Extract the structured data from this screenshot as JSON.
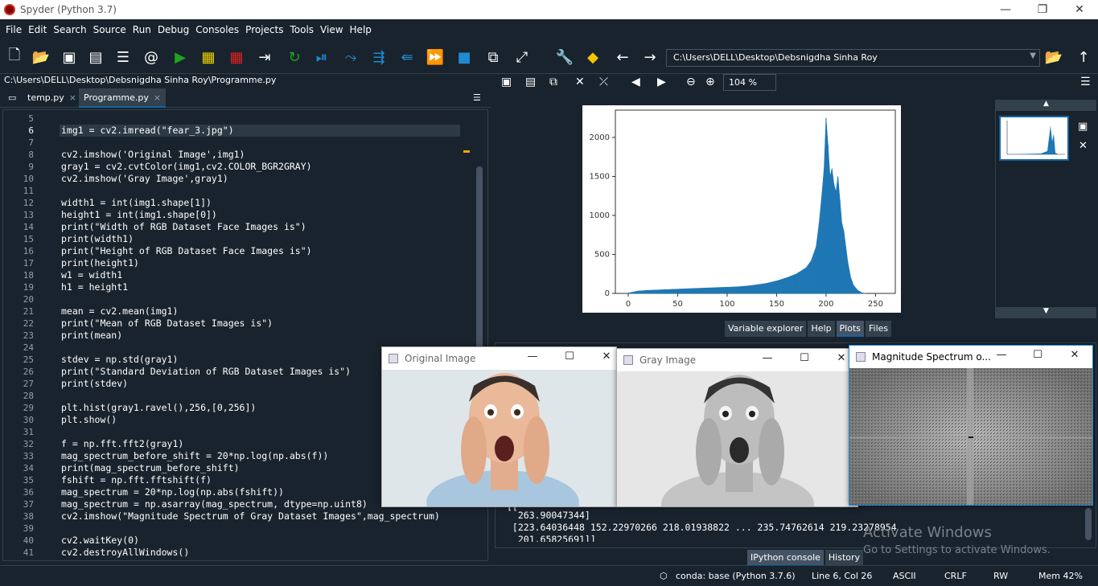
{
  "window": {
    "title": "Spyder (Python 3.7)",
    "minimize": "—",
    "restore": "❐",
    "close": "✕"
  },
  "menu": [
    "File",
    "Edit",
    "Search",
    "Source",
    "Run",
    "Debug",
    "Consoles",
    "Projects",
    "Tools",
    "View",
    "Help"
  ],
  "toolbar": {
    "path": "C:\\Users\\DELL\\Desktop\\Debsnigdha Sinha Roy"
  },
  "editor": {
    "file_path": "C:\\Users\\DELL\\Desktop\\Debsnigdha Sinha Roy\\Programme.py",
    "tabs": [
      {
        "label": "temp.py",
        "close": "×"
      },
      {
        "label": "Programme.py",
        "close": "×"
      }
    ],
    "lines": [
      {
        "n": "5",
        "code": ""
      },
      {
        "n": "6",
        "code": "img1 = cv2.imread(\"fear_3.jpg\")"
      },
      {
        "n": "7",
        "code": ""
      },
      {
        "n": "8",
        "code": "cv2.imshow('Original Image',img1)"
      },
      {
        "n": "9",
        "code": "gray1 = cv2.cvtColor(img1,cv2.COLOR_BGR2GRAY)"
      },
      {
        "n": "10",
        "code": "cv2.imshow('Gray Image',gray1)"
      },
      {
        "n": "11",
        "code": ""
      },
      {
        "n": "12",
        "code": "width1 = int(img1.shape[1])"
      },
      {
        "n": "13",
        "code": "height1 = int(img1.shape[0])"
      },
      {
        "n": "14",
        "code": "print(\"Width of RGB Dataset Face Images is\")"
      },
      {
        "n": "15",
        "code": "print(width1)"
      },
      {
        "n": "16",
        "code": "print(\"Height of RGB Dataset Face Images is\")"
      },
      {
        "n": "17",
        "code": "print(height1)"
      },
      {
        "n": "18",
        "code": "w1 = width1"
      },
      {
        "n": "19",
        "code": "h1 = height1"
      },
      {
        "n": "20",
        "code": ""
      },
      {
        "n": "21",
        "code": "mean = cv2.mean(img1)"
      },
      {
        "n": "22",
        "code": "print(\"Mean of RGB Dataset Images is\")"
      },
      {
        "n": "23",
        "code": "print(mean)"
      },
      {
        "n": "24",
        "code": ""
      },
      {
        "n": "25",
        "code": "stdev = np.std(gray1)"
      },
      {
        "n": "26",
        "code": "print(\"Standard Deviation of RGB Dataset Images is\")"
      },
      {
        "n": "27",
        "code": "print(stdev)"
      },
      {
        "n": "28",
        "code": ""
      },
      {
        "n": "29",
        "code": "plt.hist(gray1.ravel(),256,[0,256])"
      },
      {
        "n": "30",
        "code": "plt.show()"
      },
      {
        "n": "31",
        "code": ""
      },
      {
        "n": "32",
        "code": "f = np.fft.fft2(gray1)"
      },
      {
        "n": "33",
        "code": "mag_spectrum_before_shift = 20*np.log(np.abs(f))"
      },
      {
        "n": "34",
        "code": "print(mag_spectrum_before_shift)"
      },
      {
        "n": "35",
        "code": "fshift = np.fft.fftshift(f)"
      },
      {
        "n": "36",
        "code": "mag_spectrum = 20*np.log(np.abs(fshift))"
      },
      {
        "n": "37",
        "code": "mag_spectrum = np.asarray(mag_spectrum, dtype=np.uint8)"
      },
      {
        "n": "38",
        "code": "cv2.imshow(\"Magnitude Spectrum of Gray Dataset Images\",mag_spectrum)"
      },
      {
        "n": "39",
        "code": ""
      },
      {
        "n": "40",
        "code": "cv2.waitKey(0)"
      },
      {
        "n": "41",
        "code": "cv2.destroyAllWindows()"
      }
    ]
  },
  "plots": {
    "zoom": "104 %",
    "tabs": [
      "Variable explorer",
      "Help",
      "Plots",
      "Files"
    ],
    "active_tab": "Plots"
  },
  "chart_data": {
    "type": "bar",
    "title": "",
    "xlabel": "",
    "ylabel": "",
    "xlim": [
      -13,
      270
    ],
    "ylim": [
      0,
      2350
    ],
    "xticks": [
      "0",
      "50",
      "100",
      "150",
      "200",
      "250"
    ],
    "yticks": [
      "0",
      "500",
      "1000",
      "1500",
      "2000"
    ],
    "color": "#1f77b4",
    "x": [
      0,
      10,
      20,
      30,
      40,
      50,
      60,
      70,
      80,
      90,
      100,
      110,
      120,
      130,
      140,
      150,
      160,
      170,
      180,
      185,
      190,
      193,
      196,
      198,
      200,
      202,
      204,
      206,
      208,
      210,
      212,
      214,
      216,
      218,
      220,
      222,
      225,
      228,
      232,
      236,
      240
    ],
    "values": [
      5,
      30,
      40,
      45,
      50,
      55,
      60,
      65,
      70,
      75,
      80,
      85,
      95,
      110,
      130,
      160,
      200,
      250,
      330,
      420,
      600,
      900,
      1300,
      1600,
      2250,
      1900,
      1500,
      1600,
      1400,
      1300,
      1500,
      1200,
      900,
      800,
      600,
      400,
      200,
      100,
      40,
      10,
      0
    ]
  },
  "console": {
    "lines": [
      "[[",
      "  263.90047344]",
      " [223.64036448 152.22970266 218.01938822 ... 235.74762614 219.23278954",
      "  201.65825691]]"
    ],
    "tabs": [
      "IPython console",
      "History"
    ],
    "active_tab": "IPython console"
  },
  "activation": {
    "title": "Activate Windows",
    "subtitle": "Go to Settings to activate Windows."
  },
  "status": {
    "env": "conda: base (Python 3.7.6)",
    "position": "Line 6, Col 26",
    "encoding": "ASCII",
    "eol": "CRLF",
    "permissions": "RW",
    "memory": "Mem 42%"
  },
  "image_windows": [
    {
      "title": "Original Image"
    },
    {
      "title": "Gray Image"
    },
    {
      "title": "Magnitude Spectrum o..."
    }
  ]
}
